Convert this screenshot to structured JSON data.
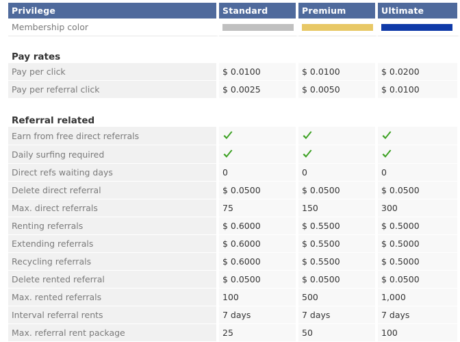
{
  "colors": {
    "header_bg": "#4f6a9c",
    "standard": "#c0c0c0",
    "premium": "#e8c866",
    "ultimate": "#0f3aa8",
    "check": "#3aa020"
  },
  "header": {
    "privilege": "Privilege",
    "standard": "Standard",
    "premium": "Premium",
    "ultimate": "Ultimate"
  },
  "membership_color_label": "Membership color",
  "sections": {
    "pay_rates": "Pay rates",
    "referral_related": "Referral related"
  },
  "pay_rates": [
    {
      "label": "Pay per click",
      "standard": "$ 0.0100",
      "premium": "$ 0.0100",
      "ultimate": "$ 0.0200"
    },
    {
      "label": "Pay per referral click",
      "standard": "$ 0.0025",
      "premium": "$ 0.0050",
      "ultimate": "$ 0.0100"
    }
  ],
  "referral_checks": [
    {
      "label": "Earn from free direct referrals",
      "icon": "check-icon"
    },
    {
      "label": "Daily surfing required",
      "icon": "check-icon"
    }
  ],
  "referral_related": [
    {
      "label": "Direct refs waiting days",
      "standard": "0",
      "premium": "0",
      "ultimate": "0"
    },
    {
      "label": "Delete direct referral",
      "standard": "$ 0.0500",
      "premium": "$ 0.0500",
      "ultimate": "$ 0.0500"
    },
    {
      "label": "Max. direct referrals",
      "standard": "75",
      "premium": "150",
      "ultimate": "300"
    },
    {
      "label": "Renting referrals",
      "standard": "$ 0.6000",
      "premium": "$ 0.5500",
      "ultimate": "$ 0.5000"
    },
    {
      "label": "Extending referrals",
      "standard": "$ 0.6000",
      "premium": "$ 0.5500",
      "ultimate": "$ 0.5000"
    },
    {
      "label": "Recycling referrals",
      "standard": "$ 0.6000",
      "premium": "$ 0.5500",
      "ultimate": "$ 0.5000"
    },
    {
      "label": "Delete rented referral",
      "standard": "$ 0.0500",
      "premium": "$ 0.0500",
      "ultimate": "$ 0.0500"
    },
    {
      "label": "Max. rented referrals",
      "standard": "100",
      "premium": "500",
      "ultimate": "1,000"
    },
    {
      "label": "Interval referral rents",
      "standard": "7 days",
      "premium": "7 days",
      "ultimate": "7 days"
    },
    {
      "label": "Max. referral rent package",
      "standard": "25",
      "premium": "50",
      "ultimate": "100"
    }
  ]
}
